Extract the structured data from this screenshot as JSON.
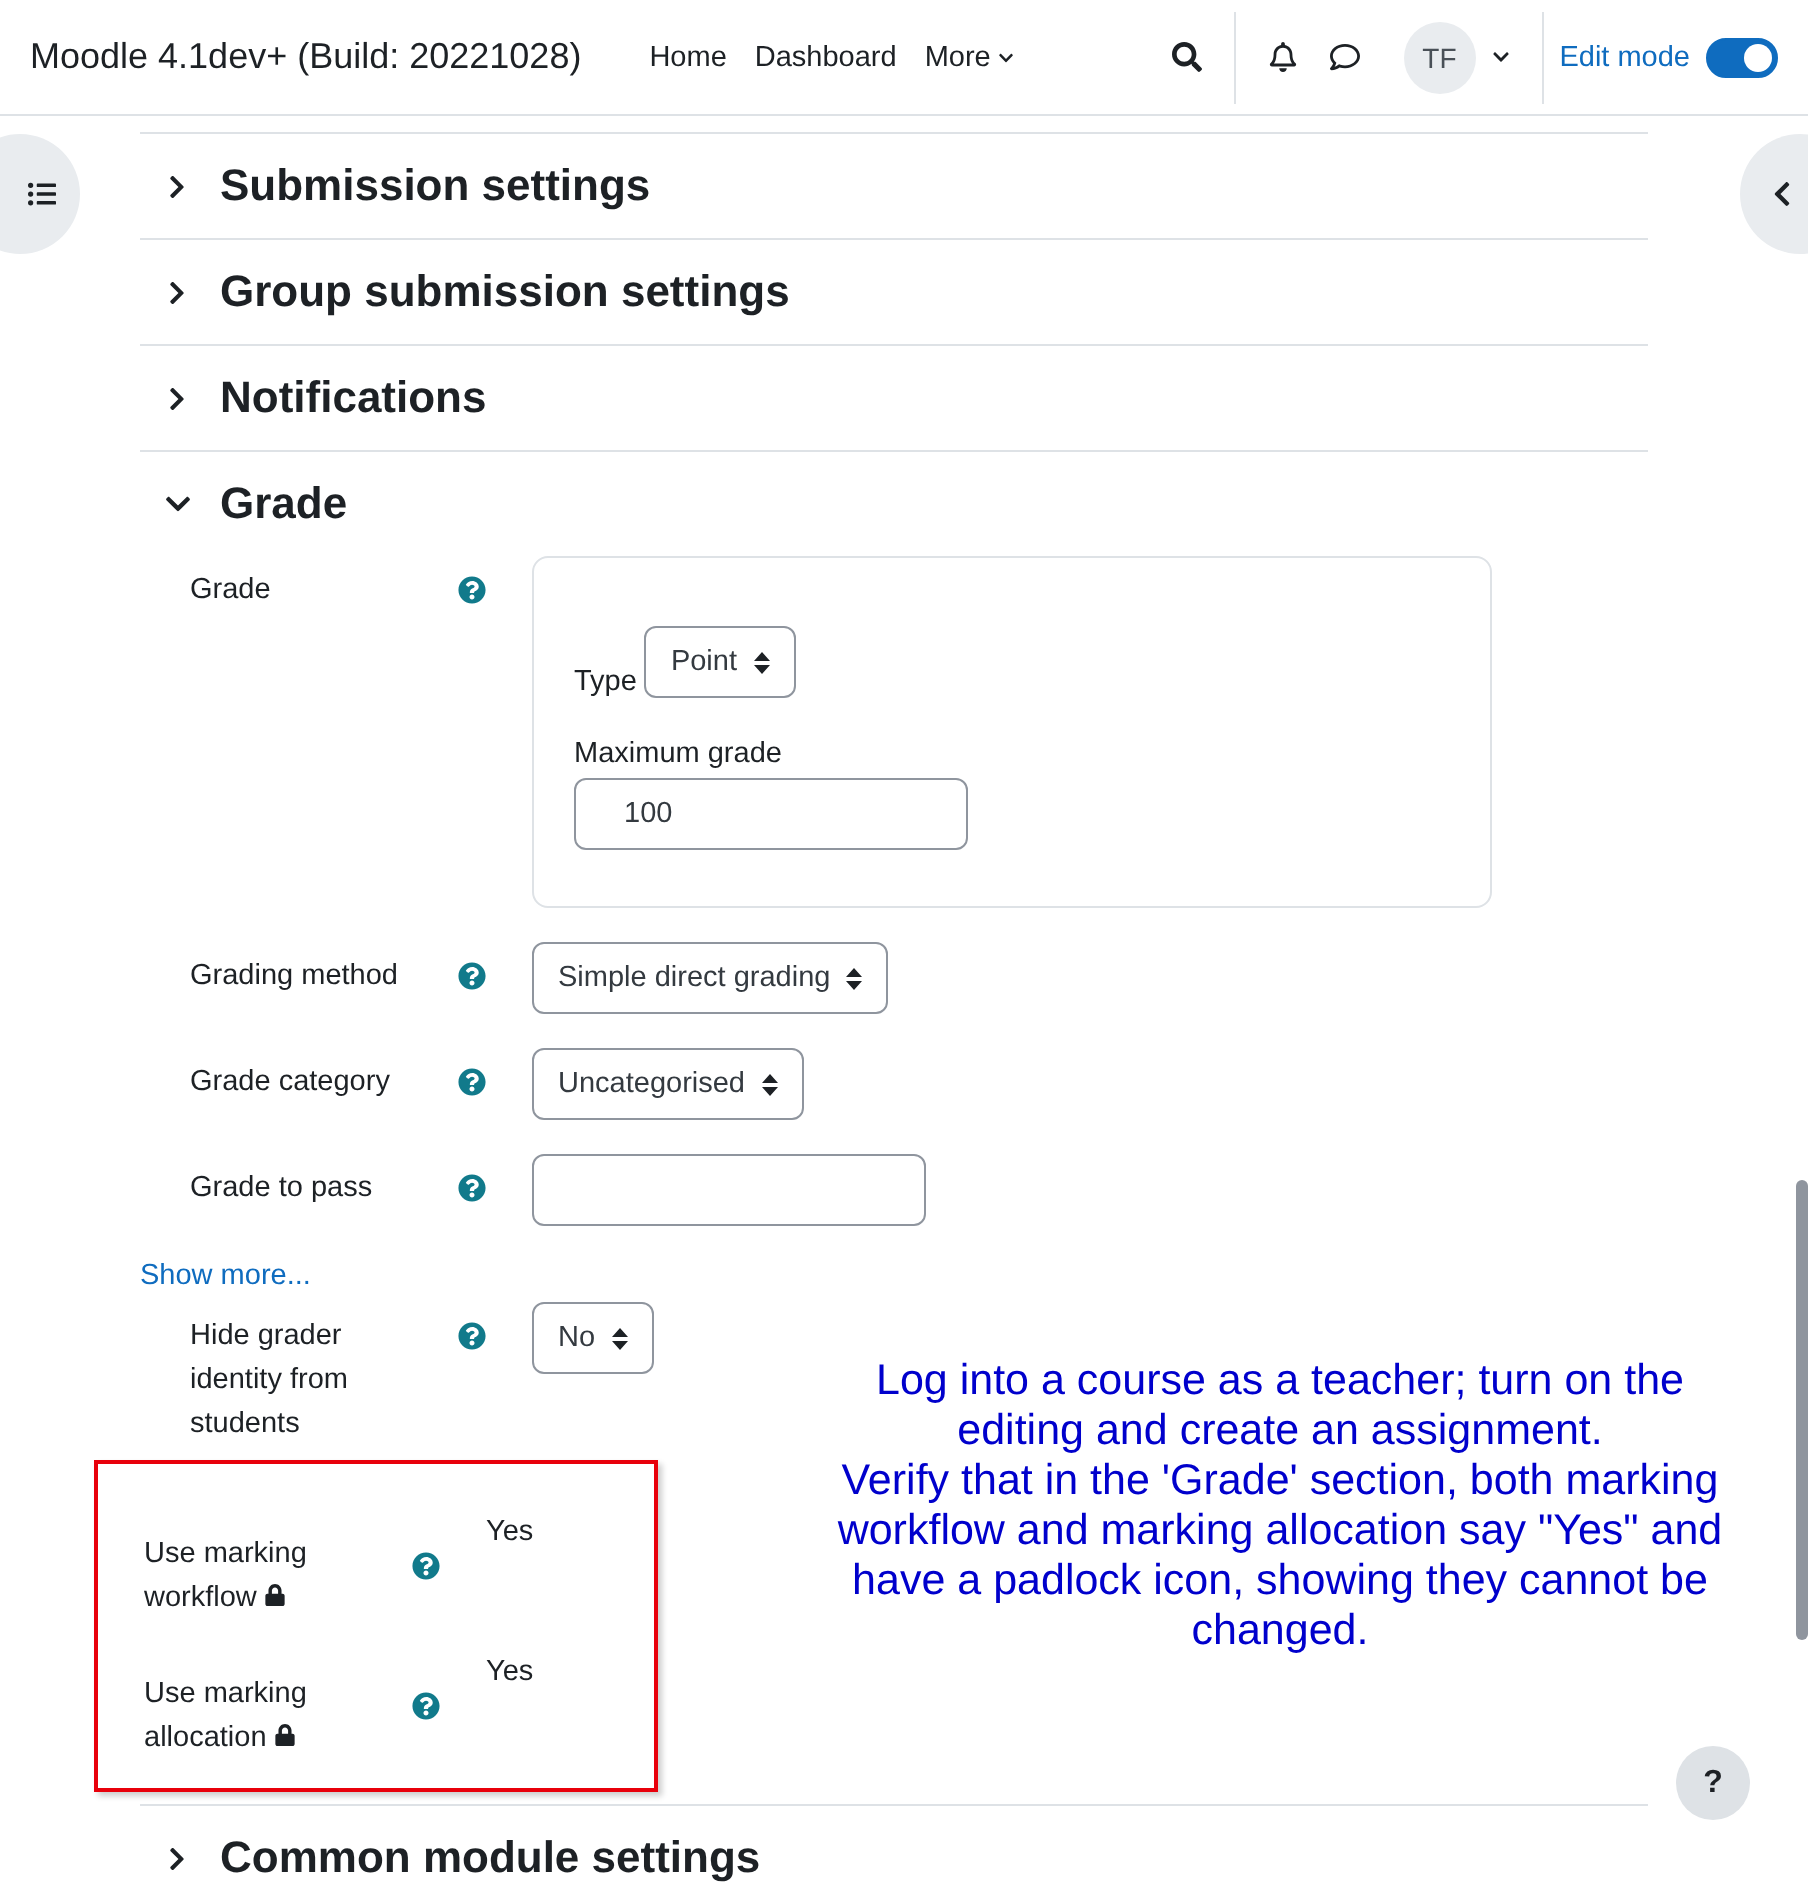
{
  "navbar": {
    "site_name": "Moodle 4.1dev+ (Build: 20221028)",
    "links": [
      {
        "label": "Home",
        "dropdown": false
      },
      {
        "label": "Dashboard",
        "dropdown": false
      },
      {
        "label": "More",
        "dropdown": true
      }
    ],
    "user_initials": "TF",
    "edit_mode": {
      "label": "Edit mode",
      "on": true
    }
  },
  "sections": [
    {
      "title": "Submission settings",
      "expanded": false
    },
    {
      "title": "Group submission settings",
      "expanded": false
    },
    {
      "title": "Notifications",
      "expanded": false
    },
    {
      "title": "Grade",
      "expanded": true,
      "fields": [
        {
          "kind": "group",
          "label": "Grade",
          "type_label": "Type",
          "type_value": "Point",
          "max_label": "Maximum grade",
          "max_value": "100"
        },
        {
          "kind": "select",
          "label": "Grading method",
          "value": "Simple direct grading"
        },
        {
          "kind": "select",
          "label": "Grade category",
          "value": "Uncategorised"
        },
        {
          "kind": "text",
          "label": "Grade to pass"
        },
        {
          "kind": "link",
          "label": "Show more..."
        },
        {
          "kind": "select",
          "label": "Hide grader identity from students",
          "value": "No"
        },
        {
          "kind": "static",
          "label": "Use marking workflow",
          "value": "Yes",
          "locked": true,
          "highlighted": true
        },
        {
          "kind": "static",
          "label": "Use marking allocation",
          "value": "Yes",
          "locked": true,
          "highlighted": true
        }
      ]
    },
    {
      "title": "Common module settings",
      "expanded": false
    }
  ],
  "annotation": [
    "Log into a course as a teacher; turn on the editing and create an assignment.",
    "Verify that in the 'Grade' section, both marking workflow and marking allocation say \"Yes\" and have a padlock icon, showing they cannot be changed."
  ],
  "help_button": "?"
}
